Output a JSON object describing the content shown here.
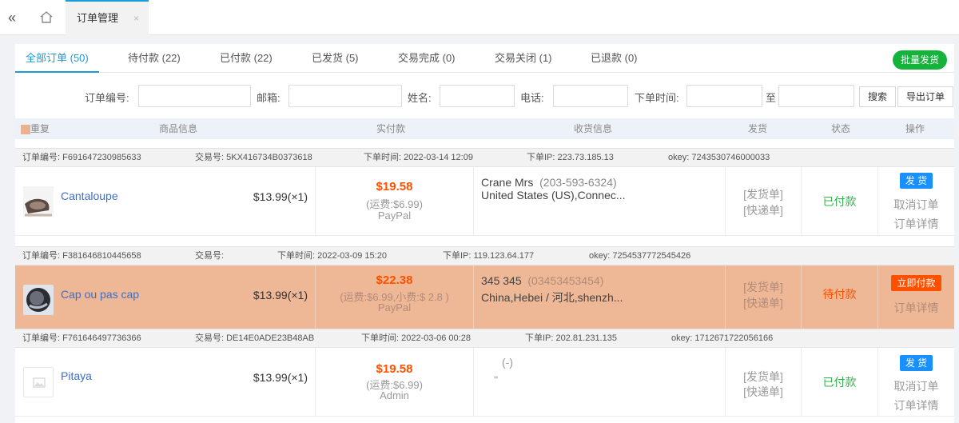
{
  "topbar": {
    "collapse_glyph": "«",
    "tab_label": "订单管理",
    "tab_close": "×"
  },
  "tabs": [
    {
      "label": "全部订单 (50)"
    },
    {
      "label": "待付款 (22)"
    },
    {
      "label": "已付款 (22)"
    },
    {
      "label": "已发货 (5)"
    },
    {
      "label": "交易完成 (0)"
    },
    {
      "label": "交易关闭 (1)"
    },
    {
      "label": "已退款 (0)"
    }
  ],
  "batch_ship_label": "批量发货",
  "filters": {
    "order_no_label": "订单编号:",
    "email_label": "邮箱:",
    "name_label": "姓名:",
    "phone_label": "电话:",
    "time_label": "下单时间:",
    "to_label": "至",
    "search_label": "搜索",
    "export_label": "导出订单"
  },
  "columns": {
    "repeat": "重复",
    "product": "商品信息",
    "paid": "实付款",
    "receiver": "收货信息",
    "ship": "发货",
    "status": "状态",
    "ops": "操作"
  },
  "orders": [
    {
      "order_no": "订单编号: F691647230985633",
      "trade_no": "交易号: 5KX416734B0373618",
      "order_time": "下单时间: 2022-03-14 12:09",
      "ip": "下单IP: 223.73.185.13",
      "okey": "okey: 7243530746000033",
      "product_name": "Cantaloupe",
      "product_price": "$13.99(×1)",
      "paid_amount": "$19.58",
      "shipping": "(运费:$6.99)",
      "pay_method": "PayPal",
      "receiver_name": "Crane Mrs",
      "receiver_phone": "(203-593-6324)",
      "receiver_addr": "United States (US),Connec...",
      "ship_order": "[发货单]",
      "express_order": "[快递单]",
      "status": "已付款",
      "op_button": "发 货",
      "op_link1": "取消订单",
      "op_link2": "订单详情"
    },
    {
      "order_no": "订单编号: F381646810445658",
      "trade_no": "交易号:",
      "order_time": "下单时间: 2022-03-09 15:20",
      "ip": "下单IP: 119.123.64.177",
      "okey": "okey: 7254537772545426",
      "product_name": "Cap ou pas cap",
      "product_price": "$13.99(×1)",
      "paid_amount": "$22.38",
      "shipping": "(运费:$6.99,小费:$ 2.8 )",
      "pay_method": "PayPal",
      "receiver_name": "345 345",
      "receiver_phone": "(03453453454)",
      "receiver_addr": "China,Hebei / 河北,shenzh...",
      "ship_order": "[发货单]",
      "express_order": "[快递单]",
      "status": "待付款",
      "op_button": "立即付款",
      "op_link1": "订单详情"
    },
    {
      "order_no": "订单编号: F761646497736366",
      "trade_no": "交易号: DE14E0ADE23B48AB",
      "order_time": "下单时间: 2022-03-06 00:28",
      "ip": "下单IP: 202.81.231.135",
      "okey": "okey: 1712671722056166",
      "product_name": "Pitaya",
      "product_price": "$13.99(×1)",
      "paid_amount": "$19.58",
      "shipping": "(运费:$6.99)",
      "pay_method": "Admin",
      "receiver_name": "(-)",
      "receiver_addr": "''",
      "ship_order": "[发货单]",
      "express_order": "[快递单]",
      "status": "已付款",
      "op_button": "发 货",
      "op_link1": "取消订单",
      "op_link2": "订单详情"
    }
  ],
  "colors": {
    "accent": "#1a9cd8",
    "paid_green": "#32b34a",
    "price_orange": "#ff5000",
    "pending_row": "#eeb796",
    "ship_blue": "#1890ff"
  }
}
